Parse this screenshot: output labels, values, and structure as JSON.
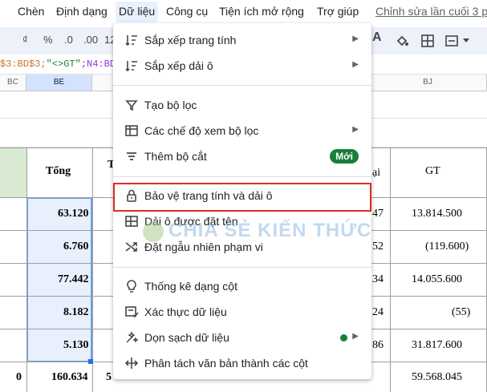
{
  "menubar": {
    "items": [
      "Chèn",
      "Định dạng",
      "Dữ liệu",
      "Công cụ",
      "Tiện ích mở rộng",
      "Trợ giúp"
    ],
    "last_edit": "Chỉnh sửa lần cuối 3 p"
  },
  "toolbar": {
    "currency": "₫",
    "percent": "%",
    "dec_decrease": ".0",
    "dec_increase": ".00",
    "number_format": "123"
  },
  "formula": {
    "part1": "$3:BD$3;",
    "part2": "\"<>GT\"",
    "part3": ";N4:BD"
  },
  "columns": {
    "bc": "BC",
    "be": "BE",
    "bj": "BJ"
  },
  "table": {
    "header_total": "Tổng",
    "header_t": "T",
    "header_ai": "ại",
    "header_gt": "GT",
    "total_values": [
      "63.120",
      "6.760",
      "77.442",
      "8.182",
      "5.130",
      "160.634"
    ],
    "mid_values": [
      "47",
      "52",
      "34",
      "24",
      "86"
    ],
    "gt_values": [
      "13.814.500",
      "(119.600)",
      "14.055.600",
      "(55)",
      "31.817.600",
      "59.568.045"
    ],
    "left_zero": "0",
    "bottom_partial": "5"
  },
  "menu": {
    "items": [
      {
        "label": "Sắp xếp trang tính",
        "icon": "sort-icon",
        "submenu": true
      },
      {
        "label": "Sắp xếp dải ô",
        "icon": "sort-range-icon",
        "submenu": true
      },
      {
        "label": "Tạo bộ lọc",
        "icon": "filter-icon"
      },
      {
        "label": "Các chế độ xem bộ lọc",
        "icon": "filter-views-icon",
        "submenu": true
      },
      {
        "label": "Thêm bộ cắt",
        "icon": "slicer-icon",
        "badge": "Mới"
      },
      {
        "label": "Bảo vệ trang tính và dải ô",
        "icon": "lock-icon"
      },
      {
        "label": "Dải ô được đặt tên",
        "icon": "named-range-icon"
      },
      {
        "label": "Đặt ngẫu nhiên phạm vi",
        "icon": "shuffle-icon"
      },
      {
        "label": "Thống kê dạng cột",
        "icon": "lightbulb-icon"
      },
      {
        "label": "Xác thực dữ liệu",
        "icon": "data-validation-icon"
      },
      {
        "label": "Dọn sạch dữ liệu",
        "icon": "cleanup-icon",
        "submenu": true
      },
      {
        "label": "Phân tách văn bản thành các cột",
        "icon": "split-icon"
      }
    ]
  },
  "watermark": "CHIA SẺ KIẾN THỨC",
  "colors": {
    "highlight": "#d93025",
    "badge": "#188038",
    "selection": "#e8f0fe"
  }
}
